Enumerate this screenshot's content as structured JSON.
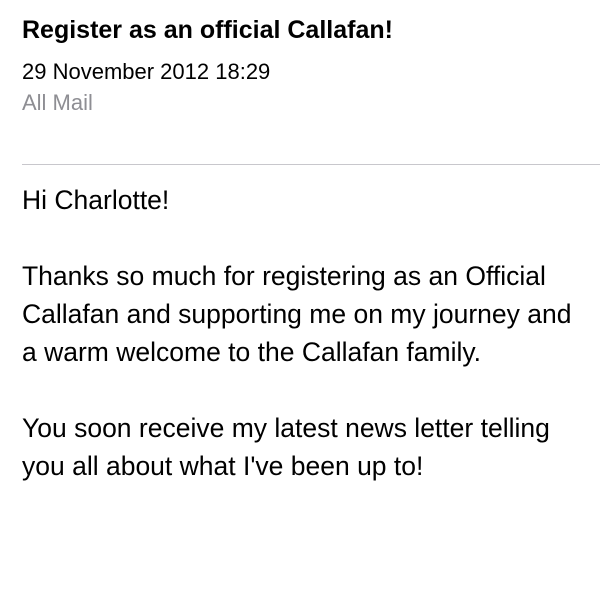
{
  "message": {
    "subject": "Register as an official Callafan!",
    "date": "29 November 2012 18:29",
    "folder": "All Mail"
  },
  "body": {
    "greeting": "Hi Charlotte!",
    "paragraph1": "Thanks so much for registering as an Official Callafan and supporting me on my journey and a warm welcome to the Callafan family.",
    "paragraph2": "You soon receive my latest news letter telling you all about what I've been up to!"
  },
  "colors": {
    "text": "#000000",
    "secondary_text": "#8e8e93",
    "divider": "#c8c7cc",
    "background": "#ffffff"
  }
}
